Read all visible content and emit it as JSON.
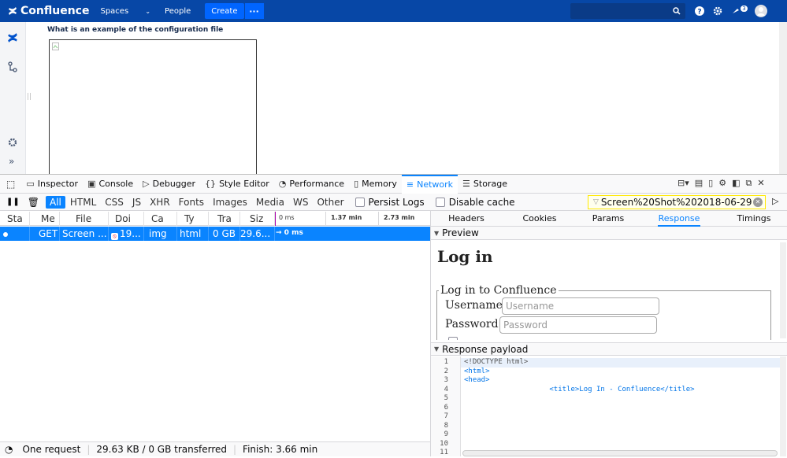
{
  "confluence": {
    "brand": "Confluence",
    "nav_spaces": "Spaces",
    "nav_people": "People",
    "create_label": "Create",
    "more_label": "···",
    "notifications_count": "3",
    "page_heading": "What is an example of the configuration file"
  },
  "devtools": {
    "tabs": [
      {
        "label": "Inspector",
        "icon": "inspector-icon"
      },
      {
        "label": "Console",
        "icon": "console-icon"
      },
      {
        "label": "Debugger",
        "icon": "debugger-icon"
      },
      {
        "label": "Style Editor",
        "icon": "style-editor-icon"
      },
      {
        "label": "Performance",
        "icon": "performance-icon"
      },
      {
        "label": "Memory",
        "icon": "memory-icon"
      },
      {
        "label": "Network",
        "icon": "network-icon"
      },
      {
        "label": "Storage",
        "icon": "storage-icon"
      }
    ],
    "active_tab": "Network",
    "filters": [
      "All",
      "HTML",
      "CSS",
      "JS",
      "XHR",
      "Fonts",
      "Images",
      "Media",
      "WS",
      "Other"
    ],
    "active_filter": "All",
    "persist_logs_label": "Persist Logs",
    "disable_cache_label": "Disable cache",
    "url_filter_value": "Screen%20Shot%202018-06-29",
    "columns": [
      "Sta",
      "Me",
      "File",
      "Doi",
      "Ca",
      "Ty",
      "Tra",
      "Siz"
    ],
    "timeline_ticks": [
      "0 ms",
      "1.37 min",
      "2.73 min"
    ],
    "request": {
      "method": "GET",
      "file": "Screen ...",
      "domain": "19...",
      "cause": "img",
      "type": "html",
      "transferred": "0 GB",
      "size": "29.6...",
      "timing": "→ 0 ms"
    },
    "status": {
      "requests": "One request",
      "size": "29.63 KB / 0 GB transferred",
      "finish": "Finish: 3.66 min"
    },
    "panel_tabs": [
      "Headers",
      "Cookies",
      "Params",
      "Response",
      "Timings"
    ],
    "active_panel_tab": "Response",
    "preview_label": "Preview",
    "preview": {
      "heading": "Log in",
      "legend": "Log in to Confluence",
      "username_label": "Username",
      "username_placeholder": "Username",
      "password_label": "Password",
      "password_placeholder": "Password"
    },
    "payload_label": "Response payload",
    "code_lines": [
      {
        "n": "1",
        "text": "<!DOCTYPE html>"
      },
      {
        "n": "2",
        "text": "<html>"
      },
      {
        "n": "3",
        "text": "<head>"
      },
      {
        "n": "4",
        "text": "                    <title>Log In - Confluence</title>"
      },
      {
        "n": "5",
        "text": ""
      },
      {
        "n": "6",
        "text": ""
      },
      {
        "n": "7",
        "text": ""
      },
      {
        "n": "8",
        "text": ""
      },
      {
        "n": "9",
        "text": ""
      },
      {
        "n": "10",
        "text": ""
      },
      {
        "n": "11",
        "text": ""
      }
    ]
  }
}
